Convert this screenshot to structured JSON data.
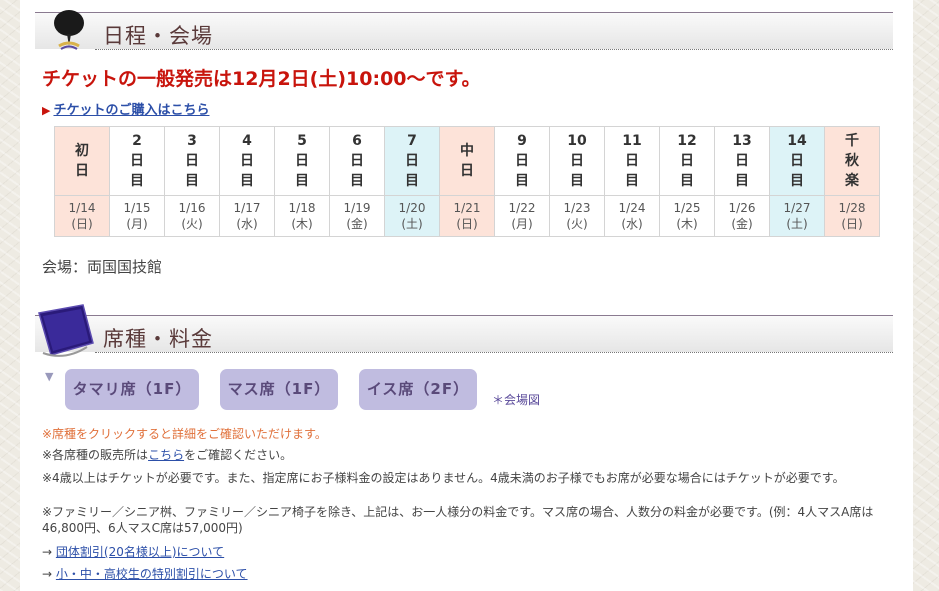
{
  "schedule_section": {
    "title": "日程・会場",
    "icon": "fan-icon"
  },
  "announcement": "チケットの一般発売は12月2日(土)10:00～です。",
  "buy_link": "チケットのご購入はこちら",
  "days": [
    {
      "lines": [
        "初",
        "日"
      ],
      "date": "1/14",
      "dow": "(日)",
      "style": "pink"
    },
    {
      "lines": [
        "2",
        "日",
        "目"
      ],
      "date": "1/15",
      "dow": "(月)",
      "style": ""
    },
    {
      "lines": [
        "3",
        "日",
        "目"
      ],
      "date": "1/16",
      "dow": "(火)",
      "style": ""
    },
    {
      "lines": [
        "4",
        "日",
        "目"
      ],
      "date": "1/17",
      "dow": "(水)",
      "style": ""
    },
    {
      "lines": [
        "5",
        "日",
        "目"
      ],
      "date": "1/18",
      "dow": "(木)",
      "style": ""
    },
    {
      "lines": [
        "6",
        "日",
        "目"
      ],
      "date": "1/19",
      "dow": "(金)",
      "style": ""
    },
    {
      "lines": [
        "7",
        "日",
        "目"
      ],
      "date": "1/20",
      "dow": "(土)",
      "style": "blue"
    },
    {
      "lines": [
        "中",
        "日"
      ],
      "date": "1/21",
      "dow": "(日)",
      "style": "pink"
    },
    {
      "lines": [
        "9",
        "日",
        "目"
      ],
      "date": "1/22",
      "dow": "(月)",
      "style": ""
    },
    {
      "lines": [
        "10",
        "日",
        "目"
      ],
      "date": "1/23",
      "dow": "(火)",
      "style": ""
    },
    {
      "lines": [
        "11",
        "日",
        "目"
      ],
      "date": "1/24",
      "dow": "(水)",
      "style": ""
    },
    {
      "lines": [
        "12",
        "日",
        "目"
      ],
      "date": "1/25",
      "dow": "(木)",
      "style": ""
    },
    {
      "lines": [
        "13",
        "日",
        "目"
      ],
      "date": "1/26",
      "dow": "(金)",
      "style": ""
    },
    {
      "lines": [
        "14",
        "日",
        "目"
      ],
      "date": "1/27",
      "dow": "(土)",
      "style": "blue"
    },
    {
      "lines": [
        "千",
        "秋",
        "楽"
      ],
      "date": "1/28",
      "dow": "(日)",
      "style": "pink"
    }
  ],
  "venue": "会場：両国国技館",
  "seats_section": {
    "title": "席種・料金",
    "icon": "cushion-icon"
  },
  "seat_buttons": [
    "タマリ席（1F）",
    "マス席（1F）",
    "イス席（2F）"
  ],
  "venue_map_link": "＊会場図",
  "notes": {
    "click_note": "※席種をクリックすると詳細をご確認いただけます。",
    "sales_prefix": "※各席種の販売所は",
    "sales_link": "こちら",
    "sales_suffix": "をご確認ください。",
    "age_note": "※4歳以上はチケットが必要です。また、指定席にお子様料金の設定はありません。4歳未満のお子様でもお席が必要な場合にはチケットが必要です。",
    "price_note": "※ファミリー／シニア桝、ファミリー／シニア椅子を除き、上記は、お一人様分の料金です。マス席の場合、人数分の料金が必要です。(例：4人マスA席は46,800円、6人マスC席は57,000円)"
  },
  "links": {
    "group_discount": "団体割引(20名様以上)について",
    "student_discount": "小・中・高校生の特別割引について",
    "arrow": "→"
  },
  "colors": {
    "announcement": "#c8140c",
    "link": "#2c4fa8",
    "seat_button": "#c0bce0",
    "note_orange": "#e0703a"
  }
}
